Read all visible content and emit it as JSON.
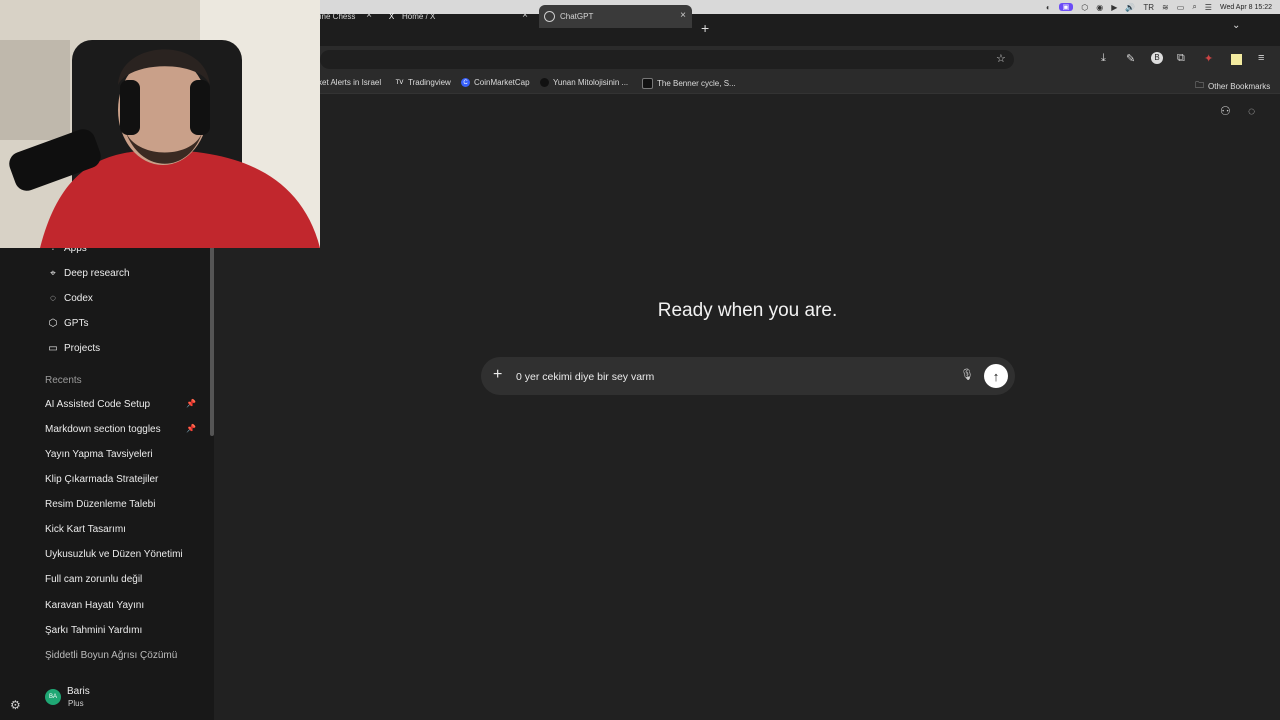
{
  "menubar": {
    "clock": "Wed Apr 8  15:22",
    "lang": "TR"
  },
  "tabs": [
    {
      "label": "line Chess",
      "icon": ""
    },
    {
      "label": "Home / X",
      "icon": "X"
    },
    {
      "label": "ChatGPT",
      "icon": ""
    }
  ],
  "bookmarks": [
    {
      "label": "ket Alerts in Israel"
    },
    {
      "label": "Tradingview",
      "icon": "TV"
    },
    {
      "label": "CoinMarketCap",
      "icon": "C"
    },
    {
      "label": "Yunan Mitolojisinin ..."
    },
    {
      "label": "The Benner cycle, S..."
    },
    {
      "label": "Other Bookmarks"
    }
  ],
  "sidebar": {
    "items": [
      {
        "label": "Apps",
        "icon": "apps-icon"
      },
      {
        "label": "Deep research",
        "icon": "telescope-icon"
      },
      {
        "label": "Codex",
        "icon": "codex-icon"
      },
      {
        "label": "GPTs",
        "icon": "cube-icon"
      },
      {
        "label": "Projects",
        "icon": "folder-icon"
      }
    ],
    "recents_label": "Recents",
    "recents": [
      "AI Assisted Code Setup",
      "Markdown section toggles",
      "Yayın Yapma Tavsiyeleri",
      "Klip Çıkarmada Stratejiler",
      "Resim Düzenleme Talebi",
      "Kick Kart Tasarımı",
      "Uykusuzluk ve Düzen Yönetimi",
      "Full cam zorunlu değil",
      "Karavan Hayatı Yayını",
      "Şarkı Tahmini Yardımı",
      "Şiddetli Boyun Ağrısı Çözümü"
    ],
    "user": {
      "initials": "BA",
      "name": "Baris",
      "plan": "Plus"
    }
  },
  "main": {
    "headline": "Ready when you are.",
    "prompt_value": "0 yer cekimi diye bir sey varm"
  },
  "colors": {
    "send_bg": "#ffffff",
    "avatar_bg": "#1fa774",
    "page_bg": "#212121"
  }
}
